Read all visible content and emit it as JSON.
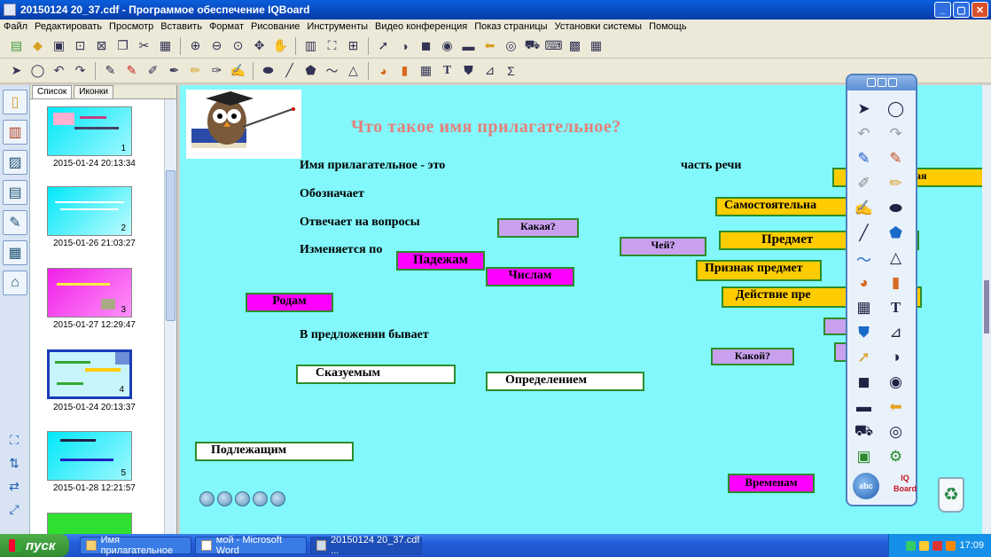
{
  "window": {
    "title": "20150124 20_37.cdf - Программое обеспечение IQBoard",
    "buttons": [
      "_",
      "▢",
      "✕"
    ]
  },
  "menu": [
    "Файл",
    "Редактировать",
    "Просмотр",
    "Вставить",
    "Формат",
    "Рисование",
    "Инструменты",
    "Видео конференция",
    "Показ страницы",
    "Установки системы",
    "Помощь"
  ],
  "thumb_panel": {
    "tabs": [
      "Список",
      "Иконки"
    ],
    "slides": [
      {
        "num": "1",
        "date": "2015-01-24 20:13:34"
      },
      {
        "num": "2",
        "date": "2015-01-26 21:03:27"
      },
      {
        "num": "3",
        "date": "2015-01-27 12:29:47"
      },
      {
        "num": "4",
        "date": "2015-01-24 20:13:37"
      },
      {
        "num": "5",
        "date": "2015-01-28 12:21:57"
      }
    ]
  },
  "slide": {
    "title": "Что такое имя прилагательное?",
    "lines": {
      "l1": "Имя прилагательное - это",
      "l1b": "часть речи",
      "l2": "Обозначает",
      "l3": "Отвечает на вопросы",
      "l4": "Изменяется по",
      "l5": "В предложении бывает"
    },
    "labels": {
      "kakaya": "Какая?",
      "chey": "Чей?",
      "kakoy": "Какой?",
      "padezham": "Падежам",
      "chislam": "Числам",
      "rodam": "Родам",
      "vremenam": "Временам",
      "skazuemym": "Сказуемым",
      "opredeleniem": "Определением",
      "podlezhashchim": "Подлежащим",
      "samostoyatelnaya": "Самостоятельна",
      "predmet": "Предмет",
      "priznak": "Признак предмет",
      "deystvie": "Действие пре",
      "yellow_top": "ая"
    }
  },
  "palette": {
    "footer_left": "abc",
    "footer_right": "IQ Board"
  },
  "taskbar": {
    "start": "пуск",
    "tasks": [
      "Имя прилагательное",
      "мой - Microsoft Word",
      "20150124 20_37.cdf ..."
    ],
    "clock": "17:09"
  }
}
